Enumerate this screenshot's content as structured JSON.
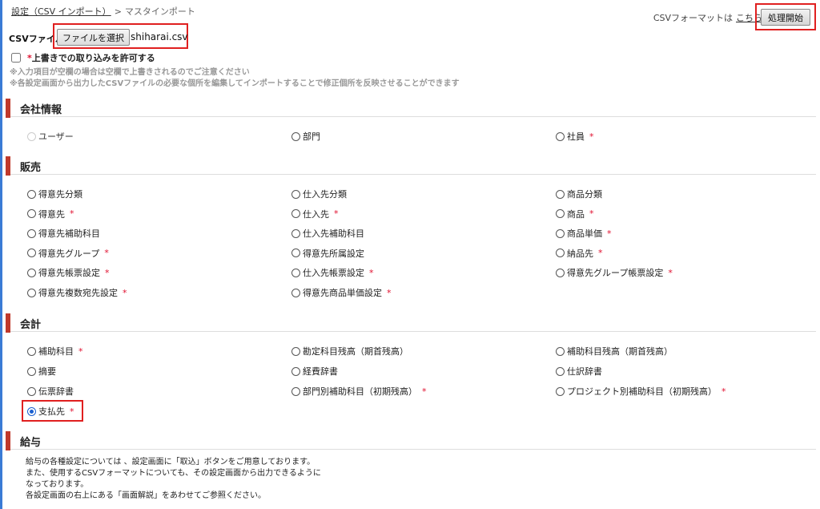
{
  "breadcrumb": {
    "link": "設定（CSV インポート）",
    "sep": ">",
    "current": "マスタインポート"
  },
  "top_right": {
    "prefix": "CSVフォーマットは",
    "link": "こちら",
    "run_button": "処理開始"
  },
  "csv": {
    "label": "CSVファイル",
    "choose_button": "ファイルを選択",
    "file_name": "shiharai.csv"
  },
  "overwrite": {
    "star": "*",
    "label": "上書きでの取り込みを許可する"
  },
  "notes": [
    "※入力項目が空欄の場合は空欄で上書きされるのでご注意ください",
    "※各設定画面から出力したCSVファイルの必要な個所を編集してインポートすることで修正個所を反映させることができます"
  ],
  "sections": {
    "company": {
      "title": "会社情報",
      "items": [
        {
          "label": "ユーザー",
          "required": false,
          "disabled": true
        },
        {
          "label": "部門",
          "required": false
        },
        {
          "label": "社員",
          "required": true
        }
      ]
    },
    "sales": {
      "title": "販売",
      "items": [
        {
          "label": "得意先分類",
          "required": false
        },
        {
          "label": "仕入先分類",
          "required": false
        },
        {
          "label": "商品分類",
          "required": false
        },
        {
          "label": "得意先",
          "required": true
        },
        {
          "label": "仕入先",
          "required": true
        },
        {
          "label": "商品",
          "required": true
        },
        {
          "label": "得意先補助科目",
          "required": false
        },
        {
          "label": "仕入先補助科目",
          "required": false
        },
        {
          "label": "商品単価",
          "required": true
        },
        {
          "label": "得意先グループ",
          "required": true
        },
        {
          "label": "得意先所属設定",
          "required": false
        },
        {
          "label": "納品先",
          "required": true
        },
        {
          "label": "得意先帳票設定",
          "required": true
        },
        {
          "label": "仕入先帳票設定",
          "required": true
        },
        {
          "label": "得意先グループ帳票設定",
          "required": true
        },
        {
          "label": "得意先複数宛先設定",
          "required": true
        },
        {
          "label": "得意先商品単価設定",
          "required": true
        }
      ]
    },
    "accounting": {
      "title": "会計",
      "items": [
        {
          "label": "補助科目",
          "required": true
        },
        {
          "label": "勘定科目残高（期首残高）",
          "required": false
        },
        {
          "label": "補助科目残高（期首残高）",
          "required": false
        },
        {
          "label": "摘要",
          "required": false
        },
        {
          "label": "経費辞書",
          "required": false
        },
        {
          "label": "仕訳辞書",
          "required": false
        },
        {
          "label": "伝票辞書",
          "required": false
        },
        {
          "label": "部門別補助科目（初期残高）",
          "required": true
        },
        {
          "label": "プロジェクト別補助科目（初期残高）",
          "required": true
        },
        {
          "label": "支払先",
          "required": true,
          "checked": true
        }
      ]
    },
    "payroll": {
      "title": "給与",
      "lines": [
        "給与の各種設定については 、設定画面に「取込」ボタンをご用意しております。",
        "また、使用するCSVフォーマットについても、その設定画面から出力できるように",
        "なっております。",
        "各設定画面の右上にある「画面解説」をあわせてご参照ください。"
      ]
    }
  },
  "star_mark": "*",
  "colors": {
    "required": "#e0102f",
    "section_bar": "#c0392b",
    "highlight_box": "#e02020",
    "radio_checked": "#1a5fd0"
  }
}
